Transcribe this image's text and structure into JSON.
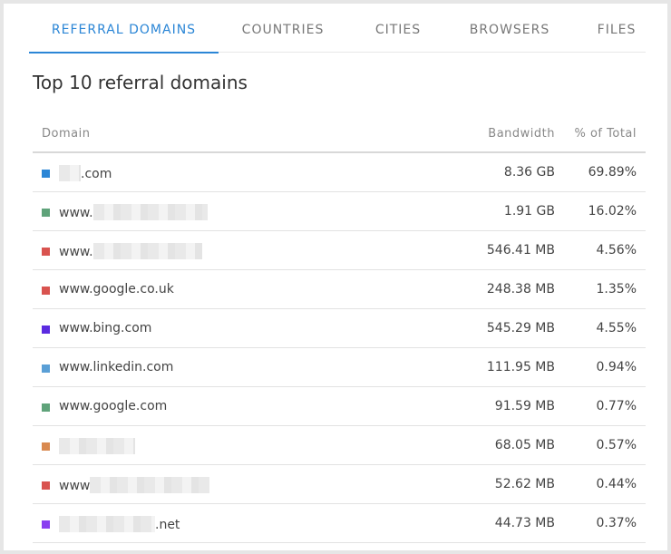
{
  "tabs": [
    {
      "label": "REFERRAL DOMAINS",
      "active": true
    },
    {
      "label": "COUNTRIES",
      "active": false
    },
    {
      "label": "CITIES",
      "active": false
    },
    {
      "label": "BROWSERS",
      "active": false
    },
    {
      "label": "FILES",
      "active": false
    }
  ],
  "title": "Top 10 referral domains",
  "columns": {
    "domain": "Domain",
    "bandwidth": "Bandwidth",
    "percent": "% of Total"
  },
  "rows": [
    {
      "prefix": "",
      "suffix": ".com",
      "bandwidth": "8.36 GB",
      "percent": "69.89%",
      "color": "#2b86d6",
      "redacted": true
    },
    {
      "prefix": "www.",
      "suffix": "",
      "bandwidth": "1.91 GB",
      "percent": "16.02%",
      "color": "#5fa37a",
      "redacted": true
    },
    {
      "prefix": "www.",
      "suffix": "",
      "bandwidth": "546.41 MB",
      "percent": "4.56%",
      "color": "#d9534f",
      "redacted": true
    },
    {
      "prefix": "www.google.co.uk",
      "suffix": "",
      "bandwidth": "248.38 MB",
      "percent": "1.35%",
      "color": "#d9534f",
      "redacted": false
    },
    {
      "prefix": "www.bing.com",
      "suffix": "",
      "bandwidth": "545.29 MB",
      "percent": "4.55%",
      "color": "#5b2be0",
      "redacted": false
    },
    {
      "prefix": "www.linkedin.com",
      "suffix": "",
      "bandwidth": "111.95 MB",
      "percent": "0.94%",
      "color": "#5a9fd6",
      "redacted": false
    },
    {
      "prefix": "www.google.com",
      "suffix": "",
      "bandwidth": "91.59 MB",
      "percent": "0.77%",
      "color": "#5fa37a",
      "redacted": false
    },
    {
      "prefix": "",
      "suffix": "",
      "bandwidth": "68.05 MB",
      "percent": "0.57%",
      "color": "#d9894f",
      "redacted": true
    },
    {
      "prefix": "www",
      "suffix": "",
      "bandwidth": "52.62 MB",
      "percent": "0.44%",
      "color": "#d9534f",
      "redacted": true
    },
    {
      "prefix": "",
      "suffix": ".net",
      "bandwidth": "44.73 MB",
      "percent": "0.37%",
      "color": "#8a3ff0",
      "redacted": true
    }
  ]
}
